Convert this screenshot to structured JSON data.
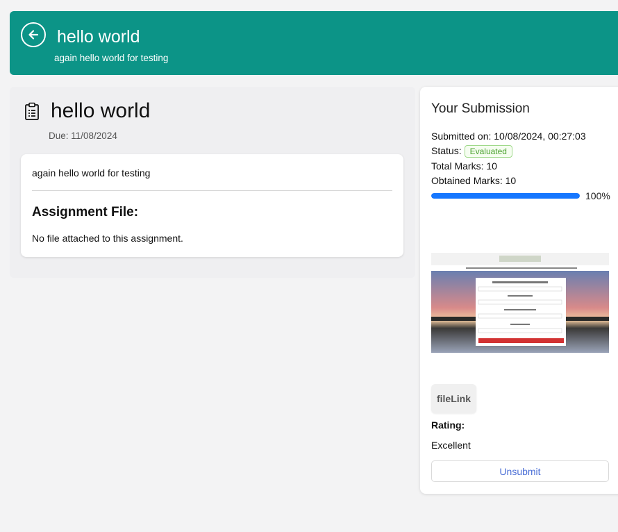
{
  "header": {
    "title": "hello world",
    "subtitle": "again hello world for testing",
    "back_icon": "arrow-left-circle-icon"
  },
  "assignment": {
    "icon": "clipboard-icon",
    "title": "hello world",
    "due": "Due: 11/08/2024",
    "description": "again hello world for testing",
    "file_heading": "Assignment File:",
    "no_file_text": "No file attached to this assignment."
  },
  "submission": {
    "title": "Your Submission",
    "submitted_on": "Submitted on: 10/08/2024, 00:27:03",
    "status_label": "Status:",
    "status_value": "Evaluated",
    "total_marks": "Total Marks: 10",
    "obtained_marks": "Obtained Marks: 10",
    "progress_percent": 100,
    "progress_label": "100%",
    "file_link_label": "fileLink",
    "rating_label": "Rating:",
    "rating_value": "Excellent",
    "unsubmit_label": "Unsubmit"
  },
  "colors": {
    "header_bg": "#0c9487",
    "progress": "#1677ff",
    "badge_green": "#4aa12e",
    "link_blue": "#4a6ed6"
  }
}
